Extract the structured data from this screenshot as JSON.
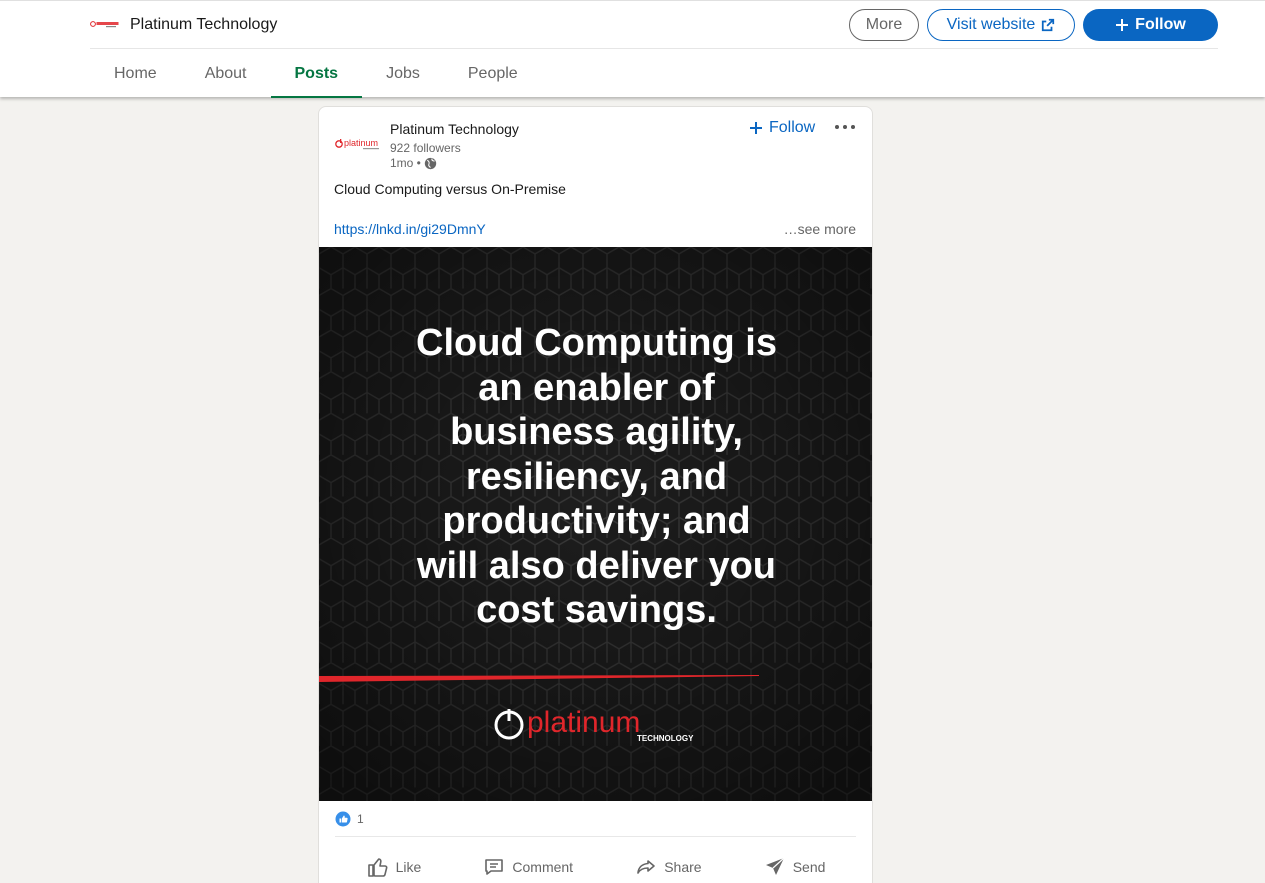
{
  "company": {
    "name": "Platinum Technology",
    "more_label": "More",
    "visit_label": "Visit website",
    "follow_label": "Follow"
  },
  "tabs": [
    {
      "label": "Home",
      "active": false
    },
    {
      "label": "About",
      "active": false
    },
    {
      "label": "Posts",
      "active": true
    },
    {
      "label": "Jobs",
      "active": false
    },
    {
      "label": "People",
      "active": false
    }
  ],
  "post": {
    "actor_name": "Platinum Technology",
    "followers": "922 followers",
    "time": "1mo •",
    "follow_label": "Follow",
    "text": "Cloud Computing versus On-Premise",
    "link": "https://lnkd.in/gi29DmnY",
    "see_more": "…see more",
    "image": {
      "quote_lines": [
        "Cloud Computing is",
        "an enabler of",
        "business agility,",
        "resiliency, and",
        "productivity; and",
        "will also deliver you",
        "cost savings."
      ],
      "brand_word": "platinum",
      "brand_sub": "TECHNOLOGY"
    },
    "reaction_count": "1",
    "actions": {
      "like": "Like",
      "comment": "Comment",
      "share": "Share",
      "send": "Send"
    }
  },
  "colors": {
    "accent_blue": "#0a66c2",
    "active_tab_green": "#057642",
    "brand_red": "#e0262b"
  }
}
